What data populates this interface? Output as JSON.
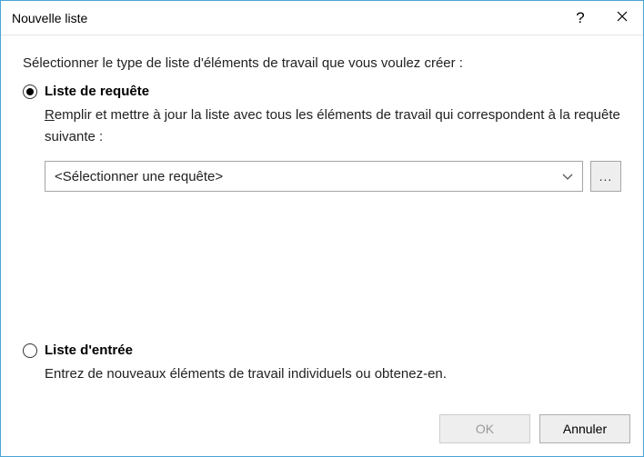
{
  "titlebar": {
    "title": "Nouvelle liste",
    "help": "?",
    "close": ""
  },
  "instruction": "Sélectionner le type de liste d'éléments de travail que vous voulez créer :",
  "option_query": {
    "label": "Liste de requête",
    "description": "Remplir et mettre à jour la liste avec tous les éléments de travail qui correspondent à la requête suivante :",
    "combobox_value": "<Sélectionner une requête>",
    "browse_label": "..."
  },
  "option_input": {
    "label": "Liste d'entrée",
    "description": "Entrez de nouveaux éléments de travail individuels ou obtenez-en."
  },
  "buttons": {
    "ok": "OK",
    "cancel": "Annuler"
  }
}
